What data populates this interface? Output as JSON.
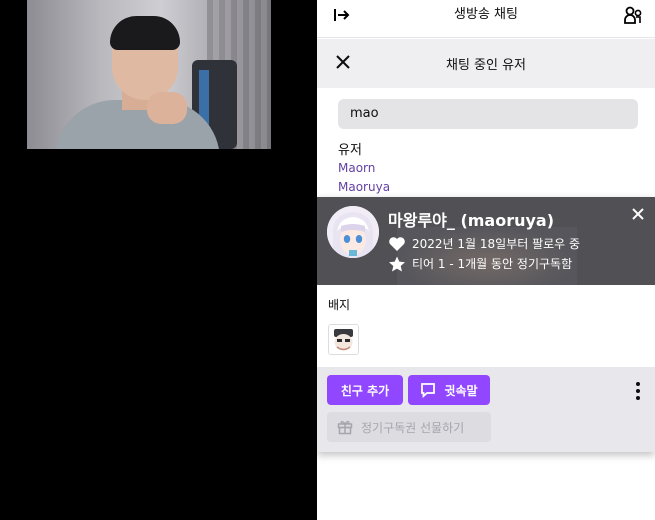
{
  "chat": {
    "header_title": "생방송 채팅"
  },
  "users_panel": {
    "title": "채팅 중인 유저",
    "search_value": "mao",
    "section_label": "유저",
    "users": [
      "Maorn",
      "Maoruya"
    ]
  },
  "viewer_card": {
    "display_name": "마왕루야_ (maoruya)",
    "follow_info": "2022년 1월 18일부터 팔로우 중",
    "sub_info": "티어 1 - 1개월 동안 정기구독함",
    "badges_label": "배지",
    "add_friend_label": "친구 추가",
    "whisper_label": "귓속말",
    "gift_sub_label": "정기구독권 선물하기"
  },
  "colors": {
    "accent": "#9147ff",
    "link": "#6441a5",
    "card_header": "#505055"
  },
  "icons": {
    "collapse": "arrow-right-to-line-icon",
    "users": "users-icon",
    "close": "close-icon",
    "heart": "heart-icon",
    "star": "star-icon",
    "whisper": "chat-bubble-icon",
    "gift": "gift-icon",
    "more": "more-vertical-icon"
  }
}
